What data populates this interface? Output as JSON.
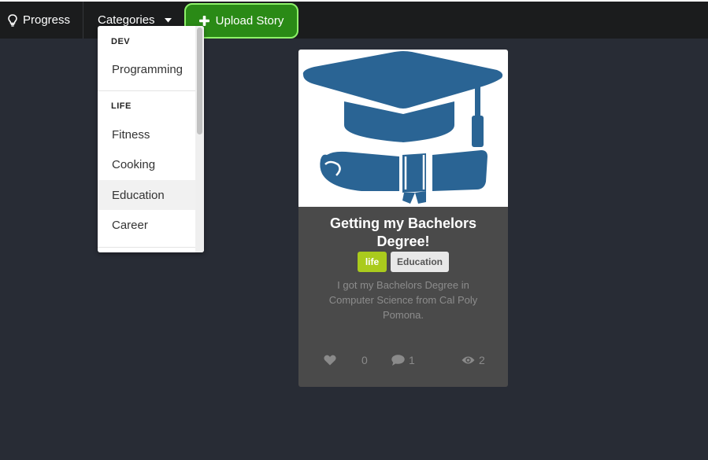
{
  "navbar": {
    "progress_label": "Progress",
    "categories_label": "Categories",
    "upload_label": "Upload Story",
    "icons": {
      "progress": "lightbulb-icon",
      "categories": "caret-down-icon",
      "upload": "plus-icon"
    }
  },
  "dropdown": {
    "groups": [
      {
        "header": "DEV",
        "items": [
          "Programming"
        ]
      },
      {
        "header": "LIFE",
        "items": [
          "Fitness",
          "Cooking",
          "Education",
          "Career"
        ]
      }
    ],
    "active_item": "Education"
  },
  "card": {
    "image": "graduation-cap-diploma",
    "title": "Getting my Bachelors Degree!",
    "tags": [
      "life",
      "Education"
    ],
    "description": "I got my Bachelors Degree in Computer Science from Cal Poly Pomona.",
    "likes": "0",
    "comments": "1",
    "views": "2"
  },
  "colors": {
    "background": "#282c35",
    "navbar": "#1b1c1d",
    "upload_button": "#2a8a16",
    "upload_border": "#8ef26a",
    "card": "#4a4a4a",
    "tag_life": "#aacb1d",
    "illustration": "#2a6494"
  }
}
